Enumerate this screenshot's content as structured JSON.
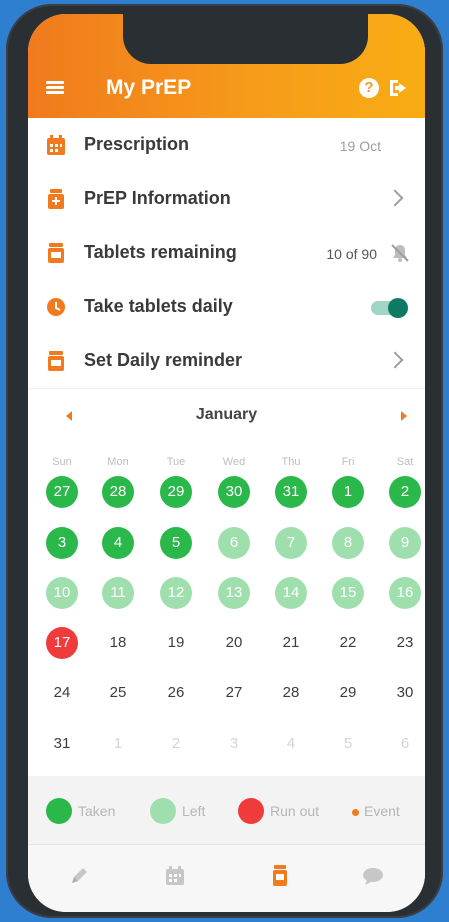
{
  "header": {
    "title": "My PrEP",
    "help_glyph": "?"
  },
  "rows": [
    {
      "label": "Prescription",
      "value": "19 Oct",
      "icon": "calendar-icon"
    },
    {
      "label": "PrEP Information",
      "icon": "info-bottle-icon"
    },
    {
      "label": "Tablets remaining",
      "value": "10 of 90",
      "icon": "pill-bottle-icon",
      "trailing_icon": "bell-off-icon"
    },
    {
      "label": "Take tablets daily",
      "icon": "clock-icon",
      "toggle_on": true
    },
    {
      "label": "Set Daily reminder",
      "icon": "pill-bottle-icon"
    }
  ],
  "calendar": {
    "month": "January",
    "weekdays": [
      "Sun",
      "Mon",
      "Tue",
      "Wed",
      "Thu",
      "Fri",
      "Sat"
    ],
    "weeks": [
      [
        {
          "d": "27",
          "s": "taken"
        },
        {
          "d": "28",
          "s": "taken"
        },
        {
          "d": "29",
          "s": "taken"
        },
        {
          "d": "30",
          "s": "taken"
        },
        {
          "d": "31",
          "s": "taken"
        },
        {
          "d": "1",
          "s": "taken"
        },
        {
          "d": "2",
          "s": "taken"
        }
      ],
      [
        {
          "d": "3",
          "s": "taken"
        },
        {
          "d": "4",
          "s": "taken"
        },
        {
          "d": "5",
          "s": "taken"
        },
        {
          "d": "6",
          "s": "left"
        },
        {
          "d": "7",
          "s": "left"
        },
        {
          "d": "8",
          "s": "left"
        },
        {
          "d": "9",
          "s": "left"
        }
      ],
      [
        {
          "d": "10",
          "s": "left"
        },
        {
          "d": "11",
          "s": "left"
        },
        {
          "d": "12",
          "s": "left"
        },
        {
          "d": "13",
          "s": "left"
        },
        {
          "d": "14",
          "s": "left"
        },
        {
          "d": "15",
          "s": "left"
        },
        {
          "d": "16",
          "s": "left"
        }
      ],
      [
        {
          "d": "17",
          "s": "runout"
        },
        {
          "d": "18",
          "s": "plain"
        },
        {
          "d": "19",
          "s": "plain"
        },
        {
          "d": "20",
          "s": "plain"
        },
        {
          "d": "21",
          "s": "plain"
        },
        {
          "d": "22",
          "s": "plain"
        },
        {
          "d": "23",
          "s": "plain"
        }
      ],
      [
        {
          "d": "24",
          "s": "plain"
        },
        {
          "d": "25",
          "s": "plain"
        },
        {
          "d": "26",
          "s": "plain"
        },
        {
          "d": "27",
          "s": "plain"
        },
        {
          "d": "28",
          "s": "plain"
        },
        {
          "d": "29",
          "s": "plain"
        },
        {
          "d": "30",
          "s": "plain"
        }
      ],
      [
        {
          "d": "31",
          "s": "plain"
        },
        {
          "d": "1",
          "s": "muted"
        },
        {
          "d": "2",
          "s": "muted"
        },
        {
          "d": "3",
          "s": "muted"
        },
        {
          "d": "4",
          "s": "muted"
        },
        {
          "d": "5",
          "s": "muted"
        },
        {
          "d": "6",
          "s": "muted"
        }
      ]
    ]
  },
  "legend": {
    "taken": "Taken",
    "left": "Left",
    "runout": "Run out",
    "event": "Event"
  },
  "tabs": [
    "pen-icon",
    "calendar-icon",
    "pill-bottle-icon",
    "chat-icon"
  ],
  "colors": {
    "accent": "#f07a1d",
    "taken": "#2bb84a",
    "left": "#9fdfae",
    "runout": "#ef3b3b",
    "toggle": "#0f7a63"
  }
}
